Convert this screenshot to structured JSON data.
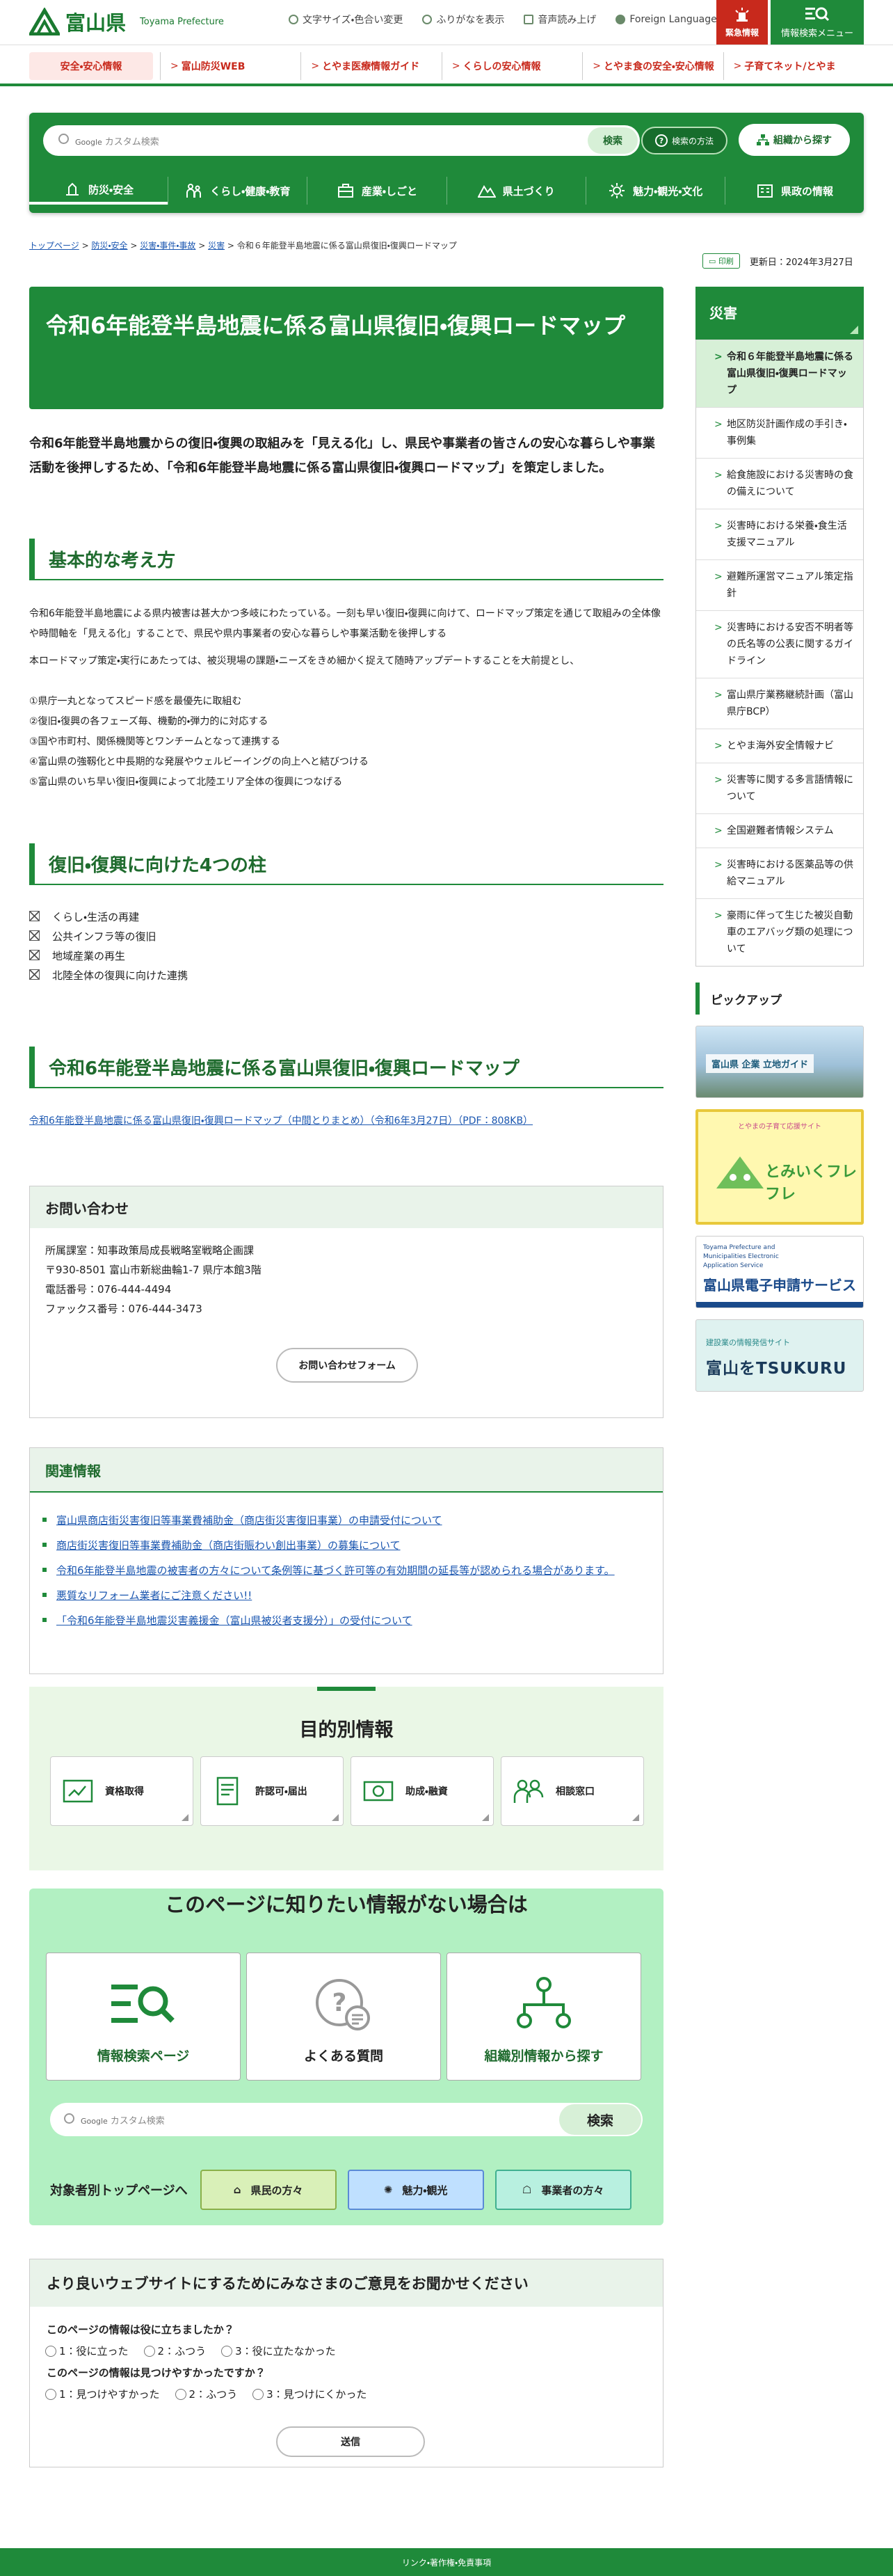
{
  "header": {
    "logo_text": "富山県",
    "logo_en": "Toyama Prefecture",
    "util": [
      "文字サイズ・色合い変更",
      "ふりがなを表示",
      "音声読み上げ",
      "Foreign Language"
    ],
    "emergency": "緊急情報",
    "search_menu": "情報検索メニュー"
  },
  "quicklinks": [
    "安全・安心情報",
    "富山防災WEB",
    "とやま医療情報ガイド",
    "くらしの安心情報",
    "とやま食の安全・安心情報",
    "子育てネット/とやま"
  ],
  "search": {
    "placeholder": "カスタム検索",
    "google": "Google",
    "button": "検索",
    "how": "検索の方法",
    "org": "組織から探す"
  },
  "gnav": [
    "防災・安全",
    "くらし・健康・教育",
    "産業・しごと",
    "県土づくり",
    "魅力・観光・文化",
    "県政の情報"
  ],
  "breadcrumb": {
    "items": [
      "トップページ",
      "防災・安全",
      "災害・事件・事故",
      "災害"
    ],
    "current": "令和６年能登半島地震に係る富山県復旧・復興ロードマップ"
  },
  "print_label": "印刷",
  "updated": "更新日：2024年3月27日",
  "page_title": "令和6年能登半島地震に係る富山県復旧・復興ロードマップ",
  "intro": "令和6年能登半島地震からの復旧・復興の取組みを「見える化」し、県民や事業者の皆さんの安心な暮らしや事業活動を後押しするため、「令和6年能登半島地震に係る富山県復旧・復興ロードマップ」を策定しました。",
  "sections": {
    "basic_title": "基本的な考え方",
    "basic_p1": "令和6年能登半島地震による県内被害は甚大かつ多岐にわたっている。一刻も早い復旧・復興に向けて、ロードマップ策定を通じて取組みの全体像や時間軸を「見える化」することで、県民や県内事業者の安心な暮らしや事業活動を後押しする",
    "basic_p2": "本ロードマップ策定・実行にあたっては、被災現場の課題・ニーズをきめ細かく捉えて随時アップデートすることを大前提とし、",
    "basic_points": [
      "①県庁一丸となってスピード感を最優先に取組む",
      "②復旧・復興の各フェーズ毎、機動的・弾力的に対応する",
      "③国や市町村、関係機関等とワンチームとなって連携する",
      "④富山県の強靱化と中長期的な発展やウェルビーイングの向上へと結びつける",
      "⑤富山県のいち早い復旧・復興によって北陸エリア全体の復興につなげる"
    ],
    "pillars_title": "復旧・復興に向けた4つの柱",
    "pillars": [
      "くらし・生活の再建",
      "公共インフラ等の復旧",
      "地域産業の再生",
      "北陸全体の復興に向けた連携"
    ],
    "roadmap_title": "令和6年能登半島地震に係る富山県復旧・復興ロードマップ",
    "roadmap_link": "令和6年能登半島地震に係る富山県復旧・復興ロードマップ（中間とりまとめ）（令和6年3月27日）（PDF：808KB）"
  },
  "contact": {
    "title": "お問い合わせ",
    "dept": "所属課室：知事政策局成長戦略室戦略企画課",
    "address": "〒930-8501 富山市新総曲輪1-7 県庁本館3階",
    "tel": "電話番号：076-444-4494",
    "fax": "ファックス番号：076-444-3473",
    "form_button": "お問い合わせフォーム"
  },
  "related": {
    "title": "関連情報",
    "items": [
      "富山県商店街災害復旧等事業費補助金（商店街災害復旧事業）の申請受付について",
      "商店街災害復旧等事業費補助金（商店街賑わい創出事業）の募集について",
      "令和6年能登半島地震の被害者の方々について条例等に基づく許可等の有効期間の延長等が認められる場合があります。",
      "悪質なリフォーム業者にご注意ください!!",
      "「令和6年能登半島地震災害義援金（富山県被災者支援分）」の受付について"
    ]
  },
  "purpose": {
    "title": "目的別情報",
    "cards": [
      "資格取得",
      "許認可・届出",
      "助成・融資",
      "相談窓口"
    ]
  },
  "notfound": {
    "title": "このページに知りたい情報がない場合は",
    "cards": [
      "情報検索ページ",
      "よくある質問",
      "組織別情報から探す"
    ],
    "search_placeholder": "カスタム検索",
    "search_button": "検索",
    "aud_label": "対象者別トップページへ",
    "aud": [
      "県民の方々",
      "魅力・観光",
      "事業者の方々"
    ]
  },
  "survey": {
    "title": "より良いウェブサイトにするためにみなさまのご意見をお聞かせください",
    "q1": "このページの情報は役に立ちましたか？",
    "q1_opts": [
      "1：役に立った",
      "2：ふつう",
      "3：役に立たなかった"
    ],
    "q2": "このページの情報は見つけやすかったですか？",
    "q2_opts": [
      "1：見つけやすかった",
      "2：ふつう",
      "3：見つけにくかった"
    ],
    "send": "送信"
  },
  "sidebar": {
    "title": "災害",
    "items": [
      "令和６年能登半島地震に係る富山県復旧・復興ロードマップ",
      "地区防災計画作成の手引き・事例集",
      "給食施設における災害時の食の備えについて",
      "災害時における栄養・食生活支援マニュアル",
      "避難所運営マニュアル策定指針",
      "災害時における安否不明者等の氏名等の公表に関するガイドライン",
      "富山県庁業務継続計画（富山県庁BCP）",
      "とやま海外安全情報ナビ",
      "災害等に関する多言語情報について",
      "全国避難者情報システム",
      "災害時における医薬品等の供給マニュアル",
      "豪雨に伴って生じた被災自動車のエアバッグ類の処理について"
    ],
    "pickup": "ピックアップ",
    "banners": {
      "b1": "富山県 企業 立地ガイド",
      "b2_top": "とやまの子育て応援サイト",
      "b2": "とみいくフレフレ",
      "b3_top": "Toyama Prefecture and Municipalities Electronic Application Service",
      "b3": "富山県電子申請サービス",
      "b4_top": "建設業の情報発信サイト",
      "b4": "富山をTSUKURU"
    }
  },
  "footer": "リンク・著作権・免責事項",
  "colors": {
    "green": "#1f8a3a",
    "red": "#c8291c",
    "link": "#1a56b0"
  }
}
